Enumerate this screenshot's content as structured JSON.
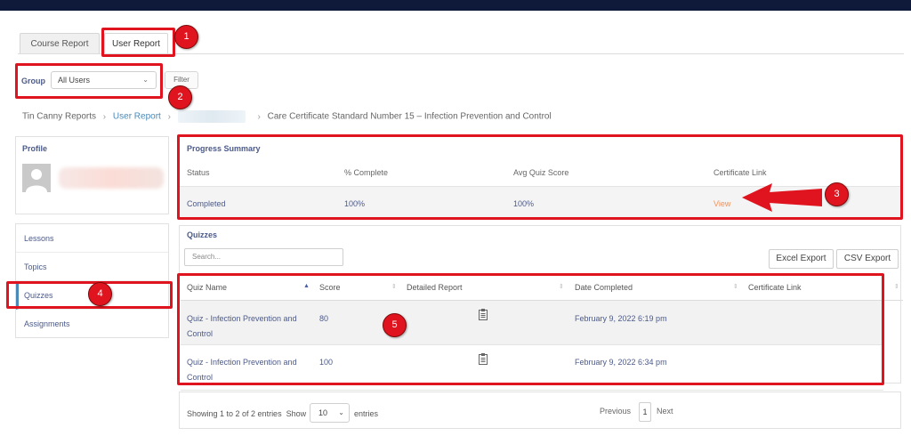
{
  "tabs": [
    {
      "label": "Course Report",
      "active": false
    },
    {
      "label": "User Report",
      "active": true
    }
  ],
  "group_filter": {
    "label": "Group",
    "selected": "All Users",
    "filter_button": "Filter"
  },
  "breadcrumb": {
    "items": [
      "Tin Canny Reports",
      "User Report"
    ],
    "current": "Care Certificate Standard Number 15 – Infection Prevention and Control"
  },
  "profile": {
    "title": "Profile"
  },
  "nav": {
    "items": [
      "Lessons",
      "Topics",
      "Quizzes",
      "Assignments"
    ],
    "active": "Quizzes"
  },
  "progress_summary": {
    "title": "Progress Summary",
    "headers": [
      "Status",
      "% Complete",
      "Avg Quiz Score",
      "Certificate Link"
    ],
    "row": {
      "status": "Completed",
      "complete": "100%",
      "avg_quiz_score": "100%",
      "certificate_link": "View"
    }
  },
  "quizzes": {
    "title": "Quizzes",
    "search_placeholder": "Search...",
    "excel_export": "Excel Export",
    "csv_export": "CSV Export",
    "headers": [
      "Quiz Name",
      "Score",
      "Detailed Report",
      "Date Completed",
      "Certificate Link"
    ],
    "rows": [
      {
        "name_line1": "Quiz - Infection Prevention and",
        "name_line2": "Control",
        "score": "80",
        "date": "February 9, 2022 6:19 pm"
      },
      {
        "name_line1": "Quiz - Infection Prevention and",
        "name_line2": "Control",
        "score": "100",
        "date": "February 9, 2022 6:34 pm"
      }
    ]
  },
  "table_footer": {
    "showing": "Showing 1 to 2 of 2 entries",
    "show_label": "Show",
    "page_length": "10",
    "entries_label": "entries",
    "previous": "Previous",
    "page": "1",
    "next": "Next"
  },
  "callouts": [
    "1",
    "2",
    "3",
    "4",
    "5"
  ],
  "colors": {
    "accent": "#4a8ab8",
    "text_link": "#4c5a8a",
    "highlight": "#e0141e",
    "view_link": "#f0935a",
    "topbar": "#0f1a3a"
  },
  "icons": [
    "chevron-down-icon",
    "sort-icon",
    "clipboard-icon",
    "avatar-icon",
    "arrow-icon"
  ]
}
